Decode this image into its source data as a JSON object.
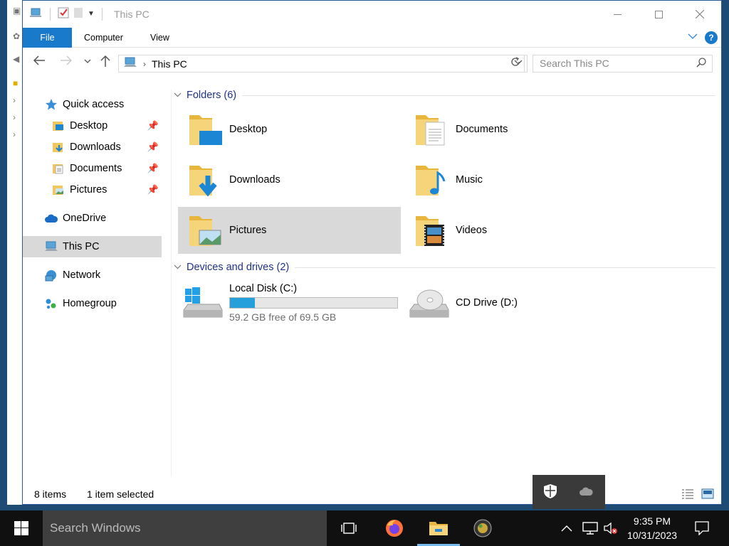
{
  "window": {
    "title": "This PC",
    "controls": {
      "minimize": "Minimize",
      "maximize": "Maximize",
      "close": "Close"
    }
  },
  "ribbon": {
    "tabs": [
      "File",
      "Computer",
      "View"
    ],
    "help": "?"
  },
  "address": {
    "crumbs": [
      "This PC"
    ],
    "search_placeholder": "Search This PC"
  },
  "sidebar": {
    "items": [
      {
        "label": "Quick access",
        "icon": "star-icon"
      },
      {
        "label": "Desktop",
        "icon": "desktop-folder-icon",
        "pinned": true
      },
      {
        "label": "Downloads",
        "icon": "downloads-folder-icon",
        "pinned": true
      },
      {
        "label": "Documents",
        "icon": "documents-folder-icon",
        "pinned": true
      },
      {
        "label": "Pictures",
        "icon": "pictures-folder-icon",
        "pinned": true
      },
      {
        "label": "OneDrive",
        "icon": "cloud-icon"
      },
      {
        "label": "This PC",
        "icon": "computer-icon",
        "selected": true
      },
      {
        "label": "Network",
        "icon": "network-icon"
      },
      {
        "label": "Homegroup",
        "icon": "homegroup-icon"
      }
    ]
  },
  "content": {
    "folders_header": "Folders (6)",
    "folders": [
      {
        "name": "Desktop",
        "icon": "desktop-folder-icon"
      },
      {
        "name": "Documents",
        "icon": "documents-folder-icon"
      },
      {
        "name": "Downloads",
        "icon": "downloads-folder-icon"
      },
      {
        "name": "Music",
        "icon": "music-folder-icon"
      },
      {
        "name": "Pictures",
        "icon": "pictures-folder-icon",
        "selected": true
      },
      {
        "name": "Videos",
        "icon": "videos-folder-icon"
      }
    ],
    "drives_header": "Devices and drives (2)",
    "drives": [
      {
        "name": "Local Disk (C:)",
        "free": "59.2 GB free of 69.5 GB",
        "used_fraction": 0.148,
        "icon": "windows-disk-icon"
      },
      {
        "name": "CD Drive (D:)",
        "icon": "cd-drive-icon"
      }
    ]
  },
  "status": {
    "count": "8 items",
    "selected": "1 item selected"
  },
  "taskbar": {
    "search_placeholder": "Search Windows",
    "time": "9:35 PM",
    "date": "10/31/2023",
    "accent": "#76b9ed"
  },
  "colors": {
    "file_tab": "#1979ca",
    "selection": "#d9d9d9",
    "group_header": "#1e3287",
    "progress": "#26a0da"
  }
}
